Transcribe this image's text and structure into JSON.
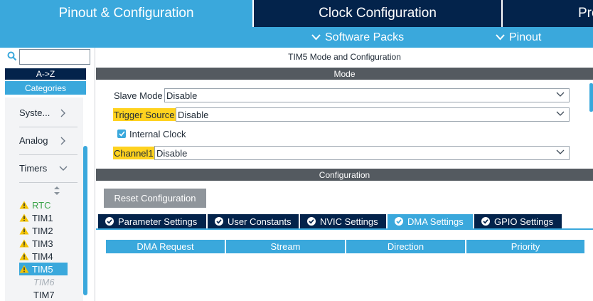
{
  "top_tabs": {
    "pinout": "Pinout & Configuration",
    "clock": "Clock Configuration",
    "project": "Pro"
  },
  "subbar": {
    "software_packs": "Software Packs",
    "pinout": "Pinout"
  },
  "sidebar": {
    "search_placeholder": "",
    "az_label": "A->Z",
    "categories_label": "Categories",
    "categories": [
      "Syste...",
      "Analog",
      "Timers"
    ],
    "timers": [
      {
        "label": "RTC",
        "warning": true,
        "state": "rtc"
      },
      {
        "label": "TIM1",
        "warning": true,
        "state": "normal"
      },
      {
        "label": "TIM2",
        "warning": true,
        "state": "normal"
      },
      {
        "label": "TIM3",
        "warning": true,
        "state": "normal"
      },
      {
        "label": "TIM4",
        "warning": true,
        "state": "normal"
      },
      {
        "label": "TIM5",
        "warning": true,
        "state": "selected"
      },
      {
        "label": "TIM6",
        "warning": false,
        "state": "disabled"
      },
      {
        "label": "TIM7",
        "warning": false,
        "state": "normal"
      }
    ]
  },
  "main": {
    "title": "TIM5 Mode and Configuration",
    "mode_header": "Mode",
    "config_header": "Configuration",
    "mode_fields": {
      "slave_mode_label": "Slave Mode",
      "slave_mode_value": "Disable",
      "trigger_source_label": "Trigger Source",
      "trigger_source_value": "Disable",
      "internal_clock_label": "Internal Clock",
      "internal_clock_checked": true,
      "channel1_label": "Channel1",
      "channel1_value": "Disable"
    },
    "reset_button": "Reset Configuration",
    "config_tabs": [
      {
        "label": "Parameter Settings",
        "active": false
      },
      {
        "label": "User Constants",
        "active": false
      },
      {
        "label": "NVIC Settings",
        "active": false
      },
      {
        "label": "DMA Settings",
        "active": true
      },
      {
        "label": "GPIO Settings",
        "active": false
      }
    ],
    "dma_table_headers": [
      "DMA Request",
      "Stream",
      "Direction",
      "Priority"
    ]
  },
  "colors": {
    "accent": "#3aa8dc",
    "navy": "#03234b",
    "header_gray": "#545a60",
    "highlight": "#ffd21f",
    "warning": "#f5c400",
    "rtc_green": "#3aa34a"
  }
}
